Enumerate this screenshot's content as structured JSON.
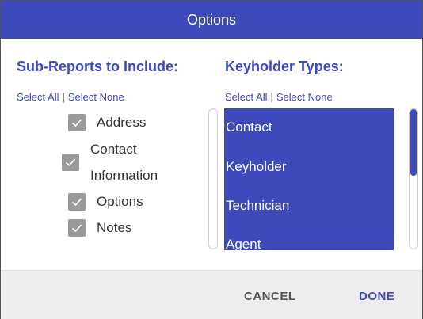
{
  "dialog": {
    "title": "Options"
  },
  "sub_reports": {
    "heading": "Sub-Reports to Include:",
    "select_all": "Select All",
    "separator": "|",
    "select_none": "Select None",
    "items": [
      {
        "label": "Address",
        "checked": true
      },
      {
        "label_line1": "Contact",
        "label_line2": "Information",
        "checked": true
      },
      {
        "label": "Options",
        "checked": true
      },
      {
        "label": "Notes",
        "checked": true
      }
    ]
  },
  "keyholder_types": {
    "heading": "Keyholder Types:",
    "select_all": "Select All",
    "separator": "|",
    "select_none": "Select None",
    "items": [
      "Contact",
      "Keyholder",
      "Technician",
      "Agent"
    ]
  },
  "footer": {
    "cancel_label": "CANCEL",
    "done_label": "DONE"
  },
  "colors": {
    "accent": "#3e49bb",
    "checkbox": "#9a9a9a",
    "footer_bg": "#ededed"
  }
}
